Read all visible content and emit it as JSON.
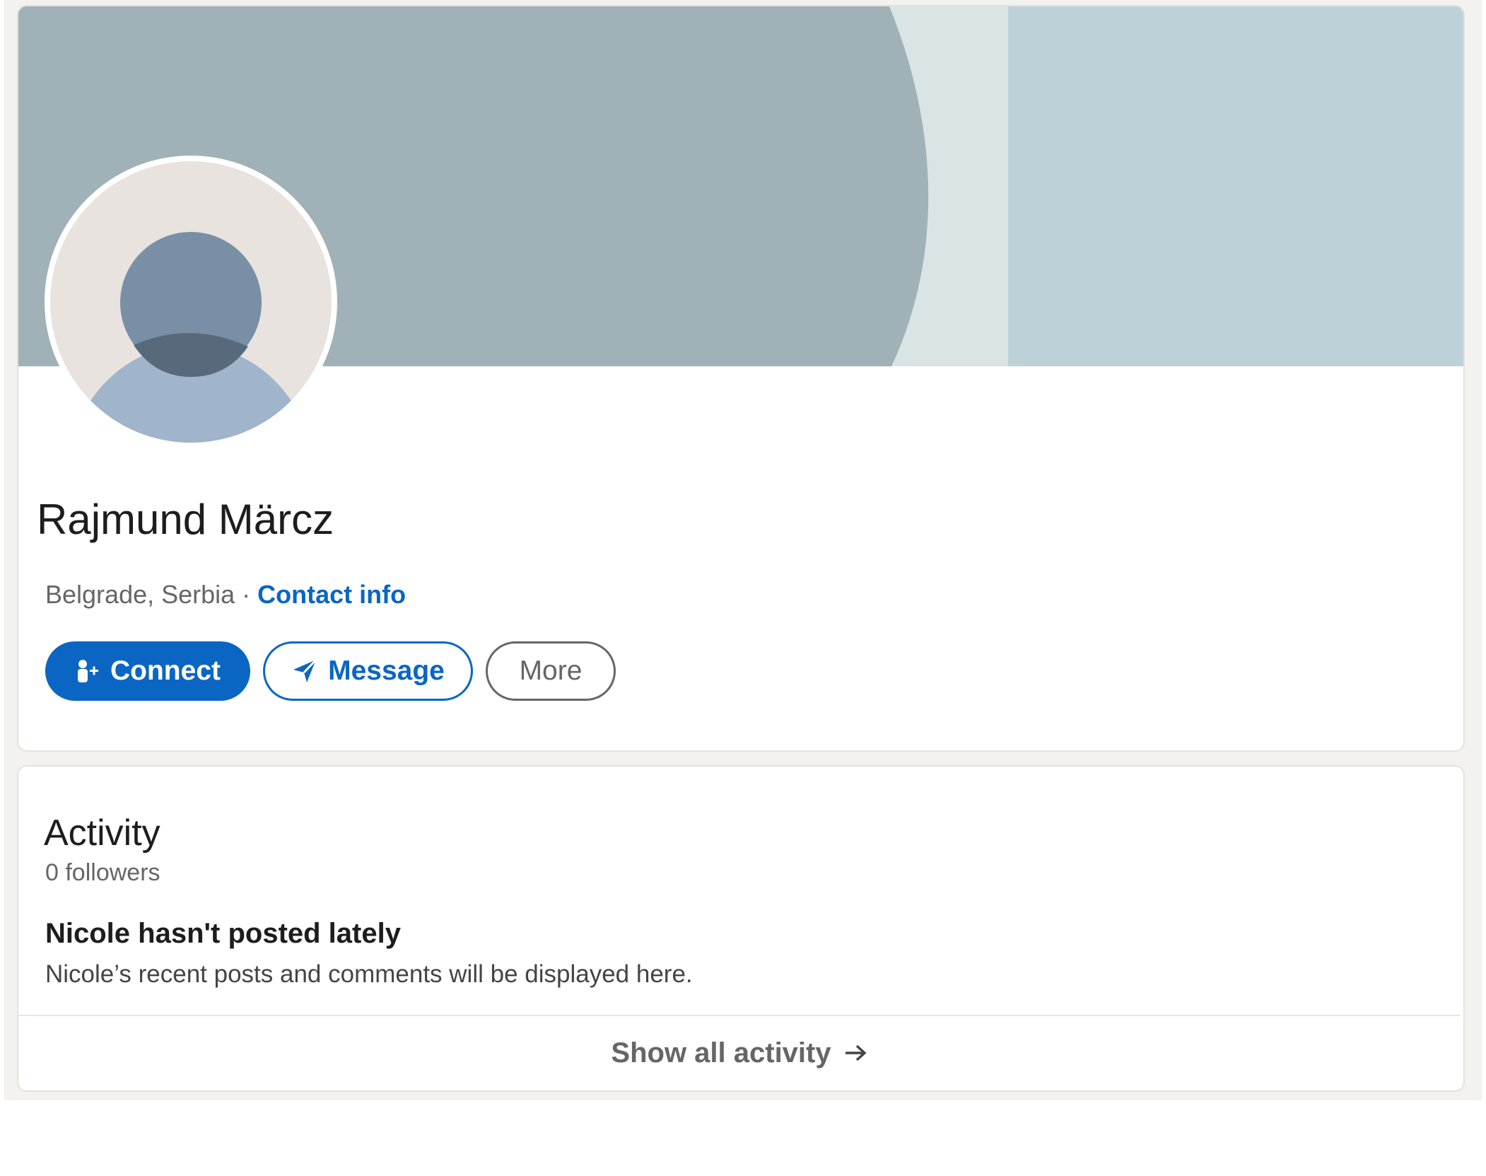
{
  "profile": {
    "name": "Rajmund Märcz",
    "location": "Belgrade, Serbia",
    "separator": "·",
    "contact_info_label": "Contact info"
  },
  "actions": {
    "connect_label": "Connect",
    "message_label": "Message",
    "more_label": "More"
  },
  "activity": {
    "title": "Activity",
    "followers": "0 followers",
    "empty_title": "Nicole hasn't posted lately",
    "empty_description": "Nicole’s recent posts and comments will be displayed here.",
    "show_all_label": "Show all activity"
  },
  "icons": {
    "connect": "add-person-icon",
    "message": "send-arrow-icon",
    "show_all": "arrow-right-icon",
    "avatar": "default-avatar-icon"
  },
  "colors": {
    "brand_blue": "#0a66c2",
    "banner_dark": "#a0b2b7",
    "banner_light": "#bdd2d8",
    "banner_stripe": "#dae4e5",
    "page_background": "#f3f2ef"
  }
}
